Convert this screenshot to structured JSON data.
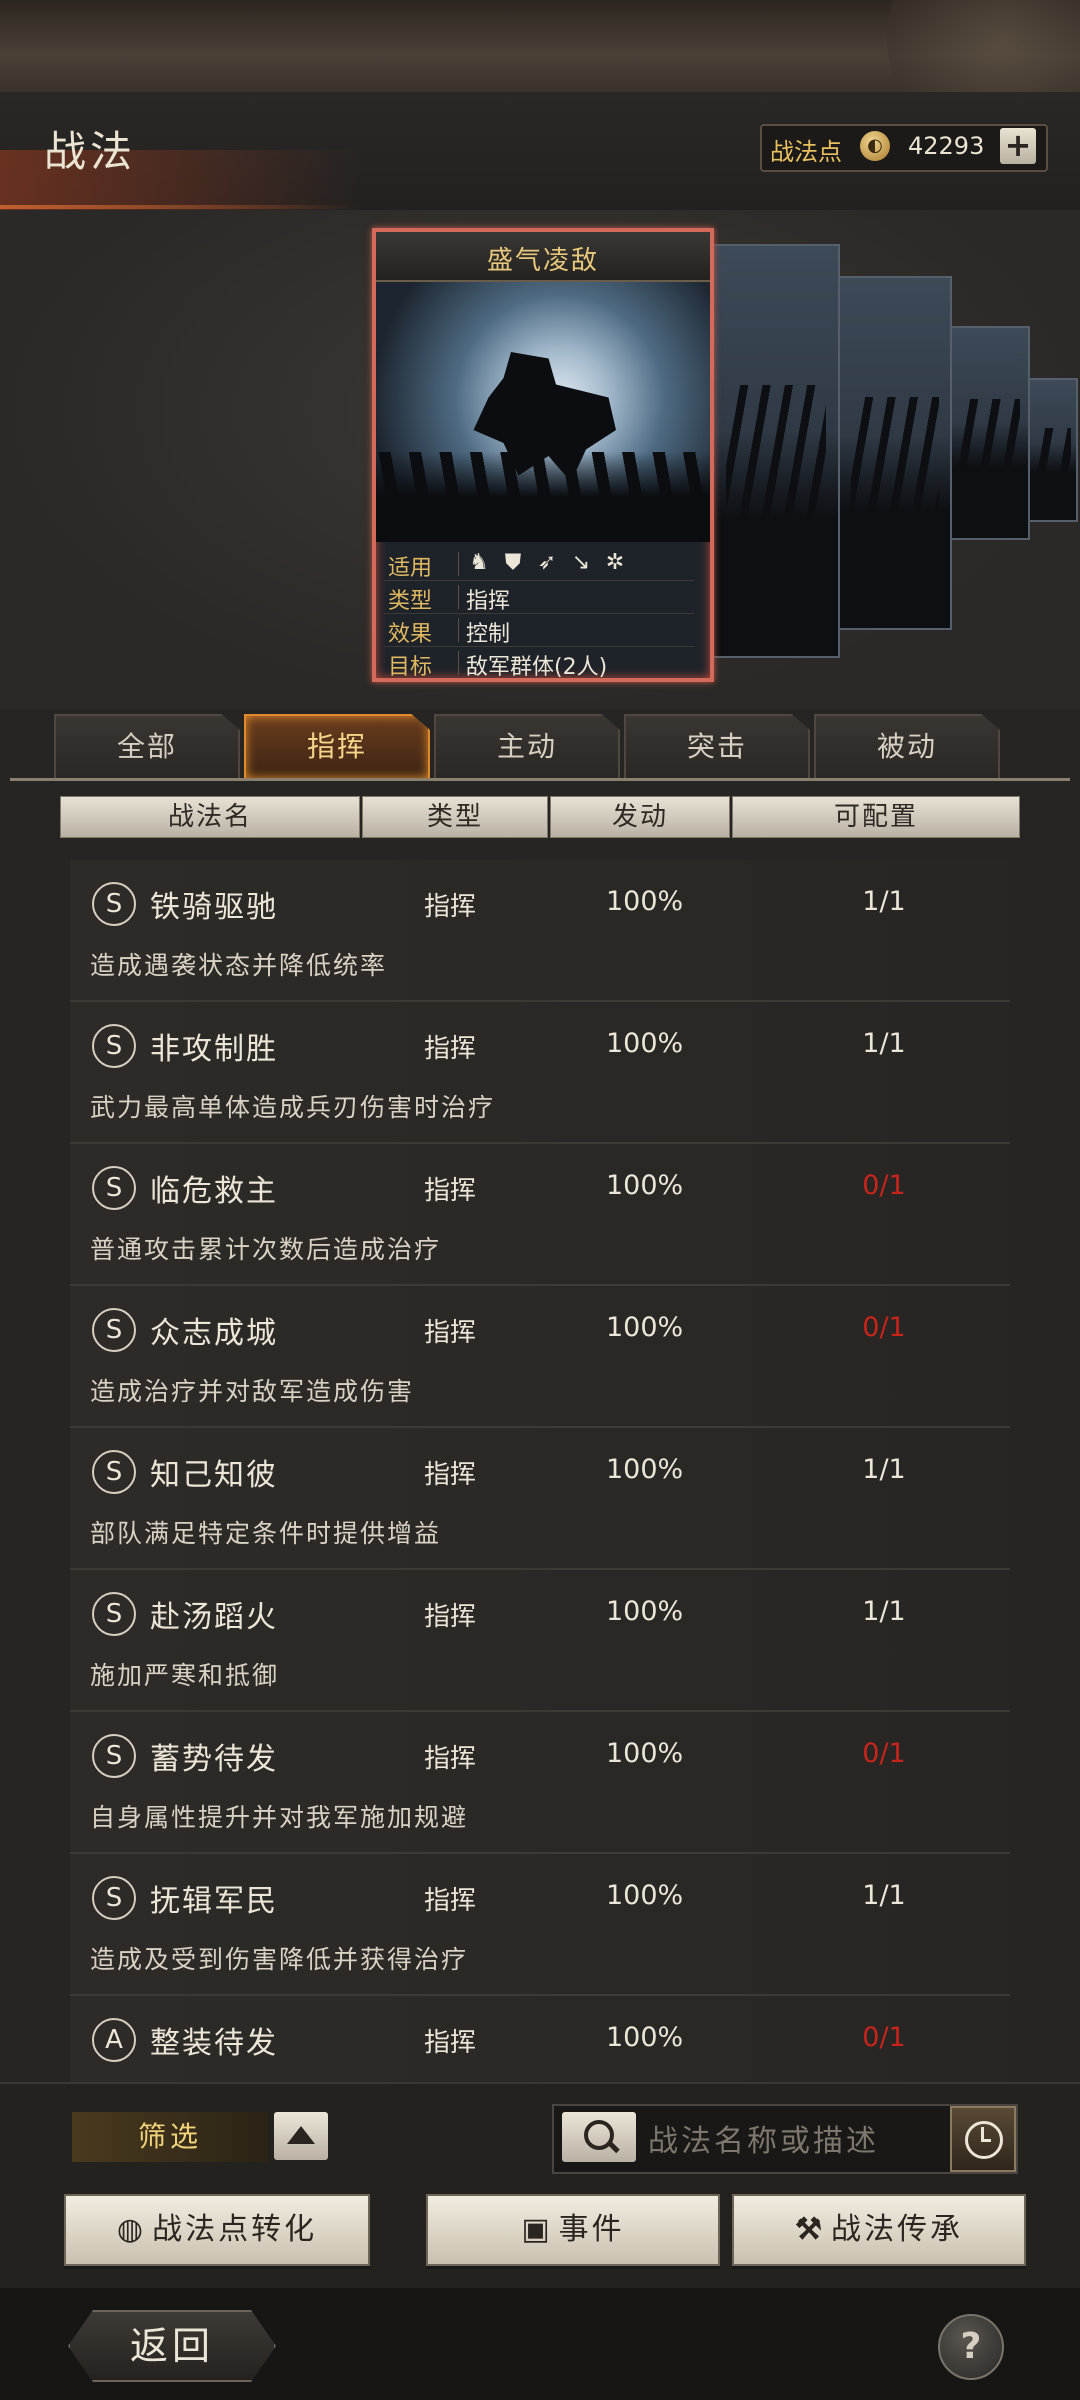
{
  "header": {
    "title": "战法",
    "points_label": "战法点",
    "points_value": "42293",
    "add_label": "+"
  },
  "card": {
    "name": "盛气凌敌",
    "info": [
      {
        "key": "适用",
        "value": ""
      },
      {
        "key": "类型",
        "value": "指挥"
      },
      {
        "key": "效果",
        "value": "控制"
      },
      {
        "key": "目标",
        "value": "敌军群体(2人)"
      }
    ],
    "unit_icons": [
      "cavalry-icon",
      "shield-icon",
      "bow-icon",
      "spear-icon",
      "wheel-icon"
    ]
  },
  "tabs": [
    {
      "label": "全部",
      "active": false
    },
    {
      "label": "指挥",
      "active": true
    },
    {
      "label": "主动",
      "active": false
    },
    {
      "label": "突击",
      "active": false
    },
    {
      "label": "被动",
      "active": false
    }
  ],
  "table": {
    "headers": [
      "战法名",
      "类型",
      "发动",
      "可配置"
    ],
    "rows": [
      {
        "grade": "S",
        "name": "铁骑驱驰",
        "type": "指挥",
        "rate": "100%",
        "config": "1/1",
        "config_red": false,
        "desc": "造成遇袭状态并降低统率"
      },
      {
        "grade": "S",
        "name": "非攻制胜",
        "type": "指挥",
        "rate": "100%",
        "config": "1/1",
        "config_red": false,
        "desc": "武力最高单体造成兵刃伤害时治疗"
      },
      {
        "grade": "S",
        "name": "临危救主",
        "type": "指挥",
        "rate": "100%",
        "config": "0/1",
        "config_red": true,
        "desc": "普通攻击累计次数后造成治疗"
      },
      {
        "grade": "S",
        "name": "众志成城",
        "type": "指挥",
        "rate": "100%",
        "config": "0/1",
        "config_red": true,
        "desc": "造成治疗并对敌军造成伤害"
      },
      {
        "grade": "S",
        "name": "知己知彼",
        "type": "指挥",
        "rate": "100%",
        "config": "1/1",
        "config_red": false,
        "desc": "部队满足特定条件时提供增益"
      },
      {
        "grade": "S",
        "name": "赴汤蹈火",
        "type": "指挥",
        "rate": "100%",
        "config": "1/1",
        "config_red": false,
        "desc": "施加严寒和抵御"
      },
      {
        "grade": "S",
        "name": "蓄势待发",
        "type": "指挥",
        "rate": "100%",
        "config": "0/1",
        "config_red": true,
        "desc": "自身属性提升并对我军施加规避"
      },
      {
        "grade": "S",
        "name": "抚辑军民",
        "type": "指挥",
        "rate": "100%",
        "config": "1/1",
        "config_red": false,
        "desc": "造成及受到伤害降低并获得治疗"
      },
      {
        "grade": "A",
        "name": "整装待发",
        "type": "指挥",
        "rate": "100%",
        "config": "0/1",
        "config_red": true,
        "desc": ""
      }
    ]
  },
  "bottom": {
    "filter_label": "筛选",
    "search_placeholder": "战法名称或描述",
    "actions": [
      {
        "icon": "coin-icon",
        "label": "战法点转化"
      },
      {
        "icon": "event-icon",
        "label": "事件"
      },
      {
        "icon": "hammer-icon",
        "label": "战法传承"
      }
    ],
    "back_label": "返回",
    "help_label": "?"
  },
  "colors": {
    "accent_gold": "#e0b860",
    "active_tab": "#e0892a",
    "config_red": "#c7241c"
  }
}
